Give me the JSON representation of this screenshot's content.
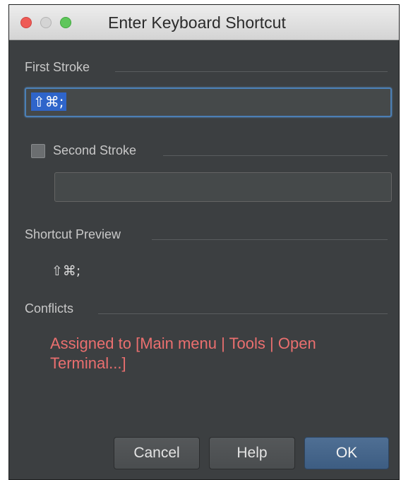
{
  "window": {
    "title": "Enter Keyboard Shortcut"
  },
  "first_stroke": {
    "label": "First Stroke",
    "value": "⇧⌘;"
  },
  "second_stroke": {
    "label": "Second Stroke",
    "checked": false,
    "value": ""
  },
  "shortcut_preview": {
    "label": "Shortcut Preview",
    "value": "⇧⌘;"
  },
  "conflicts": {
    "label": "Conflicts",
    "message": "Assigned to [Main menu | Tools | Open Terminal...]"
  },
  "buttons": {
    "cancel": "Cancel",
    "help": "Help",
    "ok": "OK"
  },
  "colors": {
    "dialog_bg": "#3c3f41",
    "conflict_text": "#ea6f6f",
    "selection": "#2f65ca",
    "focus_border": "#4b7fb5"
  },
  "icons": {
    "close": "close-traffic-light",
    "minimize": "minimize-traffic-light",
    "zoom": "zoom-traffic-light"
  }
}
